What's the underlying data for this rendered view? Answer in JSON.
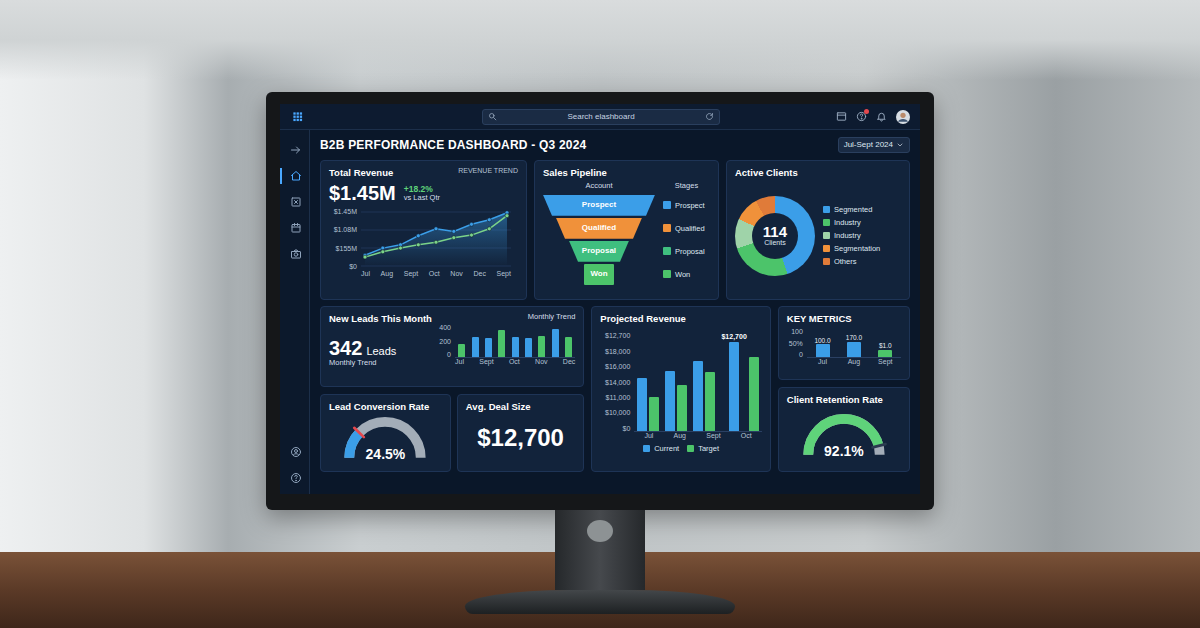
{
  "window": {
    "title": "B2B PERFORMANCE DASHBOARD - Q3 2024"
  },
  "topbar": {
    "search": {
      "placeholder": "Search elashboard"
    },
    "notifications": {
      "unread": true
    }
  },
  "sidebar": {
    "items": [
      {
        "selected": false
      },
      {
        "selected": true
      },
      {
        "selected": false
      },
      {
        "selected": false
      },
      {
        "selected": false
      }
    ],
    "footer_items": [
      {
        "selected": false
      },
      {
        "selected": false
      }
    ]
  },
  "date_range": {
    "label": "Jul-Sept 2024"
  },
  "revenue": {
    "title": "Total Revenue",
    "value": "$1.45M",
    "change": "+18.2%",
    "change_note": "vs Last Qtr",
    "trend_label": "REVENUE TREND",
    "y_ticks": [
      "$1.45M",
      "$1.08M",
      "$155M",
      "$0"
    ],
    "x_labels": [
      "Jul",
      "Aug",
      "Sept",
      "Oct",
      "Nov",
      "Dec",
      "Sept"
    ],
    "series": [
      {
        "color": "#3b9ee8",
        "values": [
          0.29,
          0.48,
          0.57,
          0.81,
          1.0,
          0.93,
          1.12,
          1.24,
          1.43
        ]
      },
      {
        "color": "#7bd389",
        "values": [
          0.24,
          0.38,
          0.48,
          0.57,
          0.64,
          0.76,
          0.83,
          1.0,
          1.35
        ]
      }
    ]
  },
  "pipeline": {
    "title": "Sales Pipeline",
    "columns": [
      "Account",
      "Stages"
    ],
    "stages": [
      {
        "label": "Prospect",
        "legend": "Prospect",
        "color": "#3b9ee8"
      },
      {
        "label": "Qualified",
        "legend": "Qualified",
        "color": "#f0913a"
      },
      {
        "label": "Proposal",
        "legend": "Proposal",
        "color": "#3fbf7f"
      },
      {
        "label": "Won",
        "legend": "Won",
        "color": "#4cc46a"
      }
    ]
  },
  "clients": {
    "title": "Active Clients",
    "center_value": "114",
    "center_label": "Clients",
    "segments": [
      {
        "label": "Segmented",
        "value": 45,
        "color": "#3b9ee8"
      },
      {
        "label": "Industry",
        "value": 25,
        "color": "#4cc46a"
      },
      {
        "label": "Industry",
        "value": 12,
        "color": "#9fd3a9"
      },
      {
        "label": "Segmentation",
        "value": 10,
        "color": "#f0913a"
      },
      {
        "label": "Others",
        "value": 8,
        "color": "#e07b39"
      }
    ]
  },
  "leads": {
    "title": "New Leads This Month",
    "value": "342",
    "unit": "Leads",
    "sub": "Monthly Trend",
    "chart_label": "Monthly Trend",
    "y_ticks": [
      "400",
      "200",
      "0"
    ],
    "x_labels": [
      "Jul",
      "Sept",
      "Oct",
      "Nov",
      "Dec"
    ],
    "bars": [
      {
        "value": 160,
        "color": "#4cc46a"
      },
      {
        "value": 240,
        "color": "#3b9ee8"
      },
      {
        "value": 230,
        "color": "#3b9ee8"
      },
      {
        "value": 320,
        "color": "#4cc46a"
      },
      {
        "value": 240,
        "color": "#3b9ee8"
      },
      {
        "value": 230,
        "color": "#3b9ee8"
      },
      {
        "value": 250,
        "color": "#4cc46a"
      },
      {
        "value": 340,
        "color": "#3b9ee8"
      },
      {
        "value": 240,
        "color": "#4cc46a"
      }
    ]
  },
  "projected": {
    "title": "Projected Revenue",
    "callout": "$12,700",
    "y_ticks": [
      "$12,700",
      "$18,000",
      "$16,000",
      "$14,000",
      "$11,000",
      "$10,000",
      "$0"
    ],
    "x_labels": [
      "Jul",
      "Aug",
      "Sept",
      "Oct"
    ],
    "series": [
      {
        "legend": "Current",
        "color": "#3b9ee8",
        "values": [
          11800,
          13400,
          15600,
          19600
        ]
      },
      {
        "legend": "Target",
        "color": "#4cc46a",
        "values": [
          7600,
          10200,
          13000,
          16400
        ]
      }
    ]
  },
  "key_metrics": {
    "title": "KEY METRICS",
    "y_ticks": [
      "100",
      "50%",
      "0"
    ],
    "bars": [
      {
        "label": "Jul",
        "value_label": "100.0",
        "value": 62,
        "color": "#3b9ee8"
      },
      {
        "label": "Aug",
        "value_label": "170.0",
        "value": 75,
        "color": "#3b9ee8"
      },
      {
        "label": "Sept",
        "value_label": "$1.0",
        "value": 35,
        "color": "#4cc46a"
      }
    ]
  },
  "conversion": {
    "title": "Lead Conversion Rate",
    "value": "24.5%",
    "level": 0.245
  },
  "deal": {
    "title": "Avg. Deal Size",
    "value": "$12,700"
  },
  "retention": {
    "title": "Client Retention Rate",
    "value": "92.1%",
    "level": 0.921
  }
}
